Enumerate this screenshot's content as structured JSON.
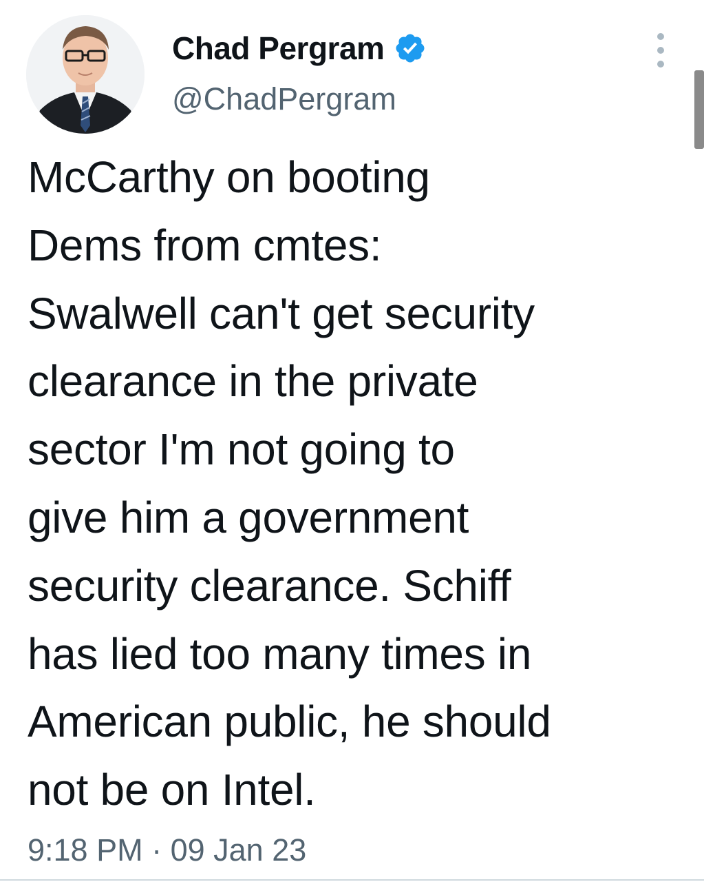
{
  "tweet": {
    "author": {
      "display_name": "Chad Pergram",
      "handle": "@ChadPergram",
      "verified_icon": "verified-badge-icon"
    },
    "text": "McCarthy on booting\nDems from cmtes:\nSwalwell can't get security\nclearance in the private\nsector I'm not going to\ngive him a government\nsecurity clearance. Schiff\nhas lied too many times in\nAmerican public, he should\nnot be on Intel.",
    "timestamp": "9:18 PM · 09 Jan 23",
    "more_icon": "more-options-icon"
  },
  "colors": {
    "text": "#0f1419",
    "secondary": "#536471",
    "verified_blue": "#1d9bf0",
    "background": "#ffffff"
  }
}
